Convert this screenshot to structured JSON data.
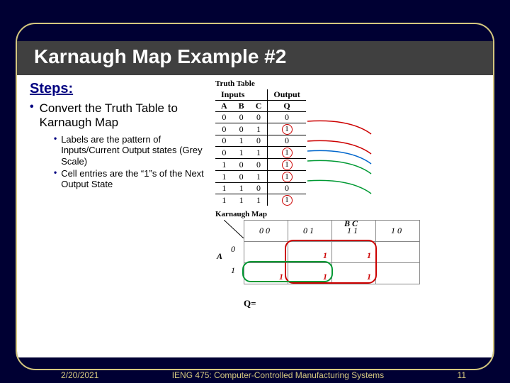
{
  "title": "Karnaugh Map Example #2",
  "steps_heading": "Steps:",
  "bullets": {
    "level1": "Convert the Truth Table to Karnaugh Map",
    "level2a": "Labels are the pattern of Inputs/Current Output states (Grey Scale)",
    "level2b": "Cell entries are the “1”s of the Next Output State"
  },
  "truth_table": {
    "label": "Truth Table",
    "inputs_label": "Inputs",
    "output_label": "Output",
    "headers": [
      "A",
      "B",
      "C",
      "Q"
    ],
    "rows": [
      [
        "0",
        "0",
        "0",
        "0"
      ],
      [
        "0",
        "0",
        "1",
        "1"
      ],
      [
        "0",
        "1",
        "0",
        "0"
      ],
      [
        "0",
        "1",
        "1",
        "1"
      ],
      [
        "1",
        "0",
        "0",
        "1"
      ],
      [
        "1",
        "0",
        "1",
        "1"
      ],
      [
        "1",
        "1",
        "0",
        "0"
      ],
      [
        "1",
        "1",
        "1",
        "1"
      ]
    ]
  },
  "kmap": {
    "label": "Karnaugh Map",
    "axis_row": "A",
    "axis_col": "B C",
    "col_headers": [
      "0 0",
      "0 1",
      "1 1",
      "1 0"
    ],
    "row_headers": [
      "0",
      "1"
    ],
    "cells": [
      [
        "",
        "1",
        "1",
        ""
      ],
      [
        "1",
        "1",
        "1",
        ""
      ]
    ],
    "q_equals": "Q="
  },
  "footer": {
    "date": "2/20/2021",
    "center": "IENG 475: Computer-Controlled Manufacturing Systems",
    "page": "11"
  },
  "chart_data": {
    "type": "table",
    "title": "Truth Table and Karnaugh Map for Q = f(A,B,C)",
    "truth_table": {
      "inputs": [
        "A",
        "B",
        "C"
      ],
      "output": "Q",
      "rows": [
        {
          "A": 0,
          "B": 0,
          "C": 0,
          "Q": 0
        },
        {
          "A": 0,
          "B": 0,
          "C": 1,
          "Q": 1
        },
        {
          "A": 0,
          "B": 1,
          "C": 0,
          "Q": 0
        },
        {
          "A": 0,
          "B": 1,
          "C": 1,
          "Q": 1
        },
        {
          "A": 1,
          "B": 0,
          "C": 0,
          "Q": 1
        },
        {
          "A": 1,
          "B": 0,
          "C": 1,
          "Q": 1
        },
        {
          "A": 1,
          "B": 1,
          "C": 0,
          "Q": 0
        },
        {
          "A": 1,
          "B": 1,
          "C": 1,
          "Q": 1
        }
      ]
    },
    "kmap": {
      "row_var": "A",
      "col_vars": "BC",
      "col_order_gray": [
        "00",
        "01",
        "11",
        "10"
      ],
      "grid": {
        "A=0": {
          "00": 0,
          "01": 1,
          "11": 1,
          "10": 0
        },
        "A=1": {
          "00": 1,
          "01": 1,
          "11": 1,
          "10": 0
        }
      }
    }
  }
}
